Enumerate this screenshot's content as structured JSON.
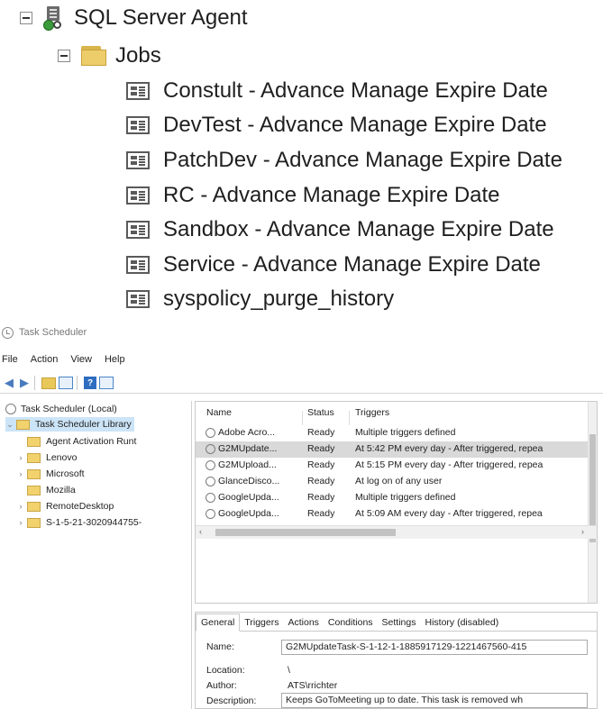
{
  "ssms": {
    "agent_label": "SQL Server Agent",
    "jobs_label": "Jobs",
    "jobs": [
      "Constult - Advance Manage Expire Date",
      "DevTest - Advance Manage Expire Date",
      "PatchDev - Advance Manage Expire Date",
      "RC - Advance Manage Expire Date",
      "Sandbox - Advance Manage Expire Date",
      "Service - Advance Manage Expire Date",
      "syspolicy_purge_history"
    ]
  },
  "task_scheduler": {
    "window_title": "Task Scheduler",
    "menu": [
      "File",
      "Action",
      "View",
      "Help"
    ],
    "tree": {
      "root": "Task Scheduler (Local)",
      "library": "Task Scheduler Library",
      "children": [
        "Agent Activation Runt",
        "Lenovo",
        "Microsoft",
        "Mozilla",
        "RemoteDesktop",
        "S-1-5-21-3020944755-"
      ]
    },
    "columns": [
      "Name",
      "Status",
      "Triggers"
    ],
    "tasks": [
      {
        "name": "Adobe Acro...",
        "status": "Ready",
        "triggers": "Multiple triggers defined"
      },
      {
        "name": "G2MUpdate...",
        "status": "Ready",
        "triggers": "At 5:42 PM every day - After triggered, repea"
      },
      {
        "name": "G2MUpload...",
        "status": "Ready",
        "triggers": "At 5:15 PM every day - After triggered, repea"
      },
      {
        "name": "GlanceDisco...",
        "status": "Ready",
        "triggers": "At log on of any user"
      },
      {
        "name": "GoogleUpda...",
        "status": "Ready",
        "triggers": "Multiple triggers defined"
      },
      {
        "name": "GoogleUpda...",
        "status": "Ready",
        "triggers": "At 5:09 AM every day - After triggered, repea"
      }
    ],
    "tabs": [
      "General",
      "Triggers",
      "Actions",
      "Conditions",
      "Settings",
      "History (disabled)"
    ],
    "props": {
      "name_label": "Name:",
      "name_value": "G2MUpdateTask-S-1-12-1-1885917129-1221467560-415",
      "location_label": "Location:",
      "location_value": "\\",
      "author_label": "Author:",
      "author_value": "ATS\\rrichter",
      "description_label": "Description:",
      "description_value": "Keeps GoToMeeting up to date. This task is removed wh"
    }
  }
}
